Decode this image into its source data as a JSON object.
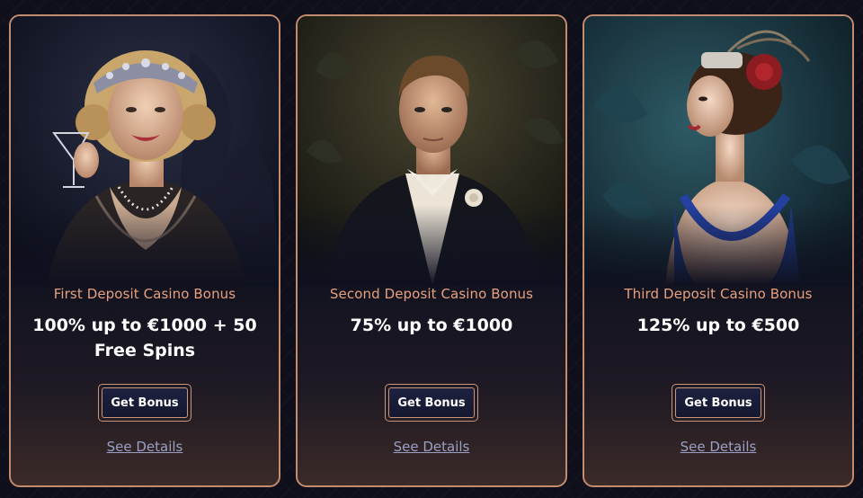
{
  "cards": [
    {
      "title": "First Deposit Casino Bonus",
      "offer": "100% up to €1000 + 50 Free Spins",
      "button_label": "Get Bonus",
      "details_label": "See Details"
    },
    {
      "title": "Second Deposit Casino Bonus",
      "offer": "75% up to €1000",
      "button_label": "Get Bonus",
      "details_label": "See Details"
    },
    {
      "title": "Third Deposit Casino Bonus",
      "offer": "125% up to €500",
      "button_label": "Get Bonus",
      "details_label": "See Details"
    }
  ],
  "colors": {
    "accent_border": "#c38c6f",
    "title_text": "#e7a07e",
    "link_text": "#9aa0c4",
    "button_bg": "#1d2140",
    "background": "#0e0f1a"
  }
}
